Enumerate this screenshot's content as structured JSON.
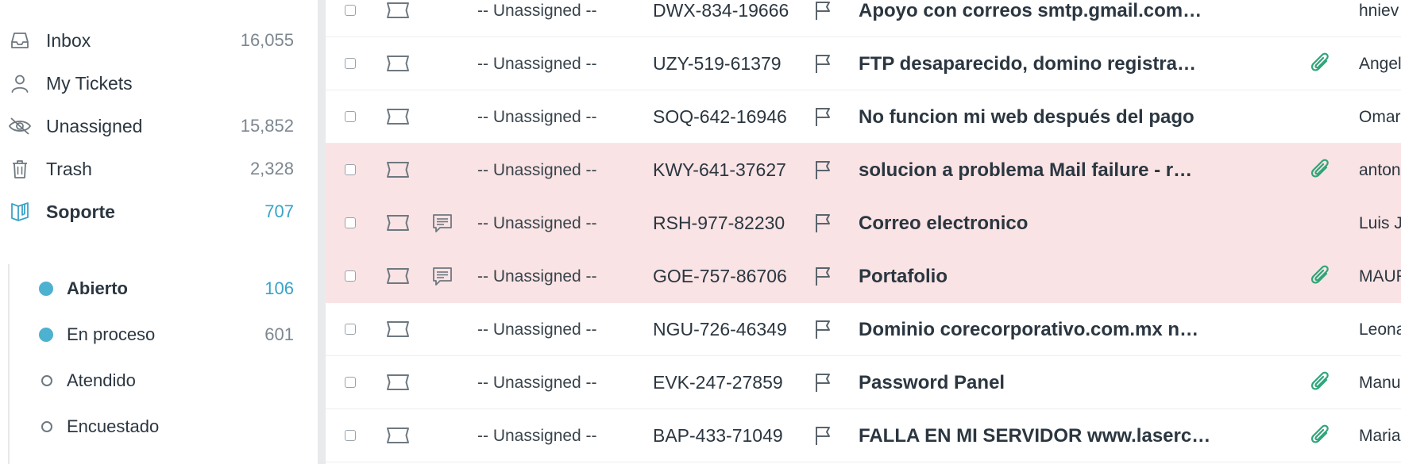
{
  "sidebar": {
    "items": [
      {
        "label": "Inbox",
        "count": "16,055",
        "icon": "inbox-icon"
      },
      {
        "label": "My Tickets",
        "count": "",
        "icon": "user-icon"
      },
      {
        "label": "Unassigned",
        "count": "15,852",
        "icon": "eye-slash-icon"
      },
      {
        "label": "Trash",
        "count": "2,328",
        "icon": "trash-icon"
      },
      {
        "label": "Soporte",
        "count": "707",
        "icon": "book-icon"
      }
    ],
    "statuses": [
      {
        "label": "Abierto",
        "count": "106"
      },
      {
        "label": "En proceso",
        "count": "601"
      },
      {
        "label": "Atendido",
        "count": ""
      },
      {
        "label": "Encuestado",
        "count": ""
      }
    ]
  },
  "colors": {
    "accent": "#3aa3c8",
    "status_dot": "#4db1d0",
    "row_highlight": "#f9e3e4",
    "attachment": "#2fa57a"
  },
  "tickets": [
    {
      "assignee": "-- Unassigned --",
      "id": "DWX-834-19666",
      "subject": "Apoyo con correos smtp.gmail.com…",
      "sender": "hniev",
      "attachment": false,
      "comment": false,
      "highlight": false
    },
    {
      "assignee": "-- Unassigned --",
      "id": "UZY-519-61379",
      "subject": "FTP desaparecido, domino registra…",
      "sender": "Angel",
      "attachment": true,
      "comment": false,
      "highlight": false
    },
    {
      "assignee": "-- Unassigned --",
      "id": "SOQ-642-16946",
      "subject": "No funcion mi web después del pago",
      "sender": "Omar",
      "attachment": false,
      "comment": false,
      "highlight": false
    },
    {
      "assignee": "-- Unassigned --",
      "id": "KWY-641-37627",
      "subject": "solucion a problema Mail failure - r…",
      "sender": "anton",
      "attachment": true,
      "comment": false,
      "highlight": true
    },
    {
      "assignee": "-- Unassigned --",
      "id": "RSH-977-82230",
      "subject": "Correo electronico",
      "sender": "Luis J",
      "attachment": false,
      "comment": true,
      "highlight": true
    },
    {
      "assignee": "-- Unassigned --",
      "id": "GOE-757-86706",
      "subject": "Portafolio",
      "sender": "MAUR",
      "attachment": true,
      "comment": true,
      "highlight": true
    },
    {
      "assignee": "-- Unassigned --",
      "id": "NGU-726-46349",
      "subject": "Dominio corecorporativo.com.mx n…",
      "sender": "Leona",
      "attachment": false,
      "comment": false,
      "highlight": false
    },
    {
      "assignee": "-- Unassigned --",
      "id": "EVK-247-27859",
      "subject": "Password Panel",
      "sender": "Manu",
      "attachment": true,
      "comment": false,
      "highlight": false
    },
    {
      "assignee": "-- Unassigned --",
      "id": "BAP-433-71049",
      "subject": "FALLA EN MI SERVIDOR www.laserc…",
      "sender": "Maria",
      "attachment": true,
      "comment": false,
      "highlight": false
    }
  ]
}
